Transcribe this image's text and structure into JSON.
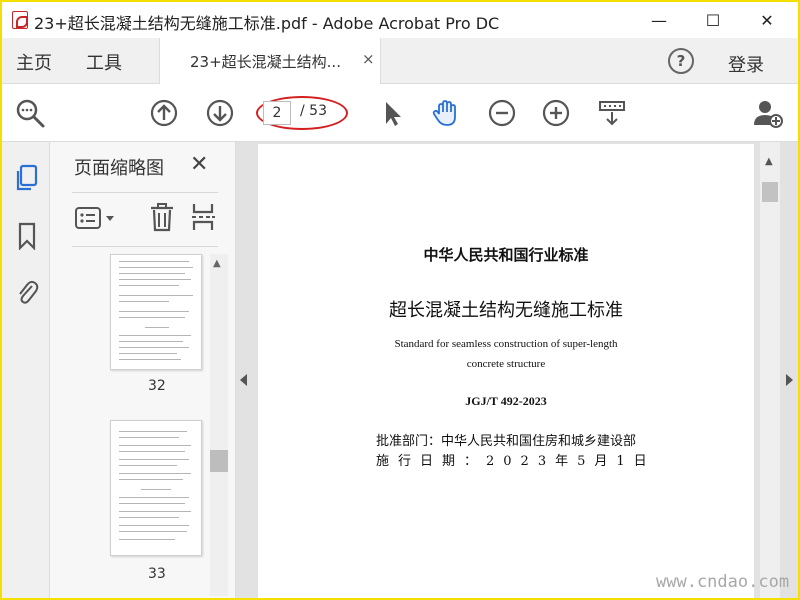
{
  "window": {
    "title": "23+超长混凝土结构无缝施工标准.pdf - Adobe Acrobat Pro DC",
    "minimize": "—",
    "maximize": "☐",
    "close": "✕"
  },
  "menu": {
    "home": "主页",
    "tools": "工具",
    "tab_label": "23+超长混凝土结构...",
    "tab_close": "×",
    "help": "?",
    "login": "登录"
  },
  "toolbar": {
    "current_page": "2",
    "total_pages": "/ 53",
    "icons": [
      "search-zoom-icon",
      "prev-page-icon",
      "next-page-icon",
      "select-cursor-icon",
      "hand-tool-icon",
      "zoom-out-icon",
      "zoom-in-icon",
      "scroll-mode-icon",
      "share-user-icon"
    ]
  },
  "sidebar": {
    "icons": [
      "page-thumbnails-icon",
      "bookmark-icon",
      "attachment-icon"
    ]
  },
  "thumbnails": {
    "title": "页面缩略图",
    "close": "✕",
    "pages": [
      {
        "label": "32"
      },
      {
        "label": "33"
      }
    ]
  },
  "document": {
    "standard_type": "中华人民共和国行业标准",
    "title_cn": "超长混凝土结构无缝施工标准",
    "title_en_line1": "Standard for seamless construction of super-length",
    "title_en_line2": "concrete structure",
    "code": "JGJ/T 492-2023",
    "approve": "批准部门：中华人民共和国住房和城乡建设部",
    "date": "施行日期：2023年5月1日"
  },
  "watermark": "www.cndao.com",
  "colors": {
    "accent_blue": "#2b6fd6",
    "highlight_red": "#d32020",
    "border_yellow": "#f5df00"
  }
}
